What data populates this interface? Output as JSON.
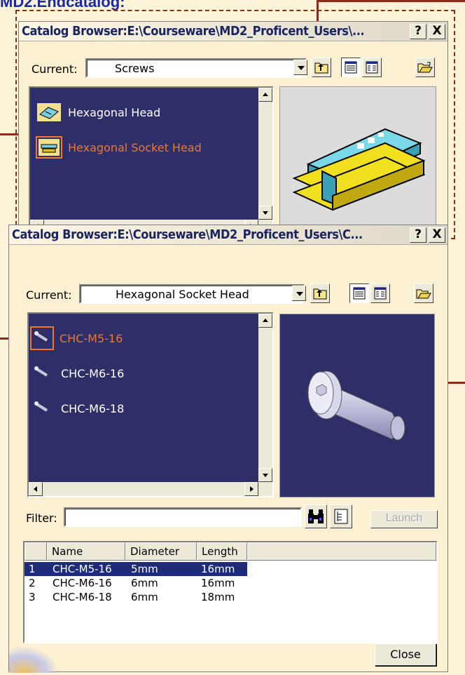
{
  "heading": "MD2.Endcatalog:",
  "top_window": {
    "title": "Catalog Browser:E:\\Courseware\\MD2_Proficent_Users\\...",
    "help_label": "?",
    "close_label": "X",
    "current_label": "Current:",
    "current_value": "Screws",
    "items": [
      {
        "label": "Hexagonal Head",
        "selected": false
      },
      {
        "label": "Hexagonal Socket Head",
        "selected": true
      }
    ]
  },
  "bottom_window": {
    "title": "Catalog Browser:E:\\Courseware\\MD2_Proficent_Users\\C...",
    "help_label": "?",
    "close_label": "X",
    "current_label": "Current:",
    "current_value": "Hexagonal Socket Head",
    "items": [
      {
        "label": "CHC-M5-16",
        "selected": true
      },
      {
        "label": "CHC-M6-16",
        "selected": false
      },
      {
        "label": "CHC-M6-18",
        "selected": false
      }
    ],
    "filter_label": "Filter:",
    "filter_value": "",
    "launch_label": "Launch",
    "table": {
      "headers": [
        "",
        "Name",
        "Diameter",
        "Length"
      ],
      "rows": [
        {
          "index": "1",
          "name": "CHC-M5-16",
          "diameter": "5mm",
          "length": "16mm",
          "selected": true
        },
        {
          "index": "2",
          "name": "CHC-M6-16",
          "diameter": "6mm",
          "length": "16mm",
          "selected": false
        },
        {
          "index": "3",
          "name": "CHC-M6-18",
          "diameter": "6mm",
          "length": "18mm",
          "selected": false
        }
      ]
    },
    "close_button_label": "Close"
  },
  "colors": {
    "background": "#fdf3d8",
    "list_background": "#2e2e68",
    "selected_text": "#f07828",
    "annotation_arrow": "#8b2c16",
    "table_selection": "#1e2c78"
  }
}
